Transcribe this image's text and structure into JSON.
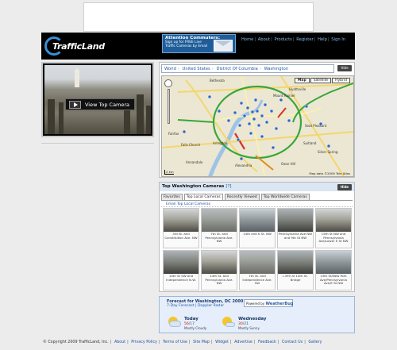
{
  "header": {
    "logo": "TrafficLand",
    "promo": {
      "title": "Attention Commuters:",
      "text": "Sign up for FREE Live Traffic Cameras by Email"
    },
    "nav": [
      "Home",
      "About",
      "Products",
      "Register",
      "Help",
      "Sign In"
    ]
  },
  "video": {
    "play_label": "View Top Camera"
  },
  "map": {
    "breadcrumbs": [
      "World",
      "United States",
      "District Of Columbia",
      "Washington"
    ],
    "hide_label": "Hide",
    "types": [
      "Map",
      "Satellite",
      "Hybrid"
    ],
    "copyright": "Map data ©2009 Tele Atlas",
    "scale": "2 km",
    "places": [
      "Bethesda",
      "Silver Spring",
      "Hyattsville",
      "Arlington",
      "Falls Church",
      "Annandale",
      "Alexandria",
      "Oxon Hill",
      "Seat Pleasant",
      "Suitland",
      "Fairfax",
      "Mount Rainier"
    ]
  },
  "cameras": {
    "title": "Top Washington Cameras",
    "help": "[?]",
    "hide_label": "Hide",
    "tabs": [
      "Favorites",
      "Top Local Cameras",
      "Recently Viewed",
      "Top Worldwide Cameras"
    ],
    "email_text": "Email Top Local Cameras",
    "items": [
      "3rd St. and Constitution Ave. NW",
      "7th St. and Pennsylvania Ave. NW",
      "14th and K St. NW",
      "Pennsylvania Ave NW and 9th St NW",
      "15th St NW and Pennsylvania Ave/Lower E St NW",
      "14th St SW and Independence N.W.",
      "14th St. and Pennsylvania Ave. NW",
      "7th St. and Independence Ave. SW",
      "I-395 at 14th St. Bridge",
      "15th St/New York Ave/Pennsylvania Ave/E St NW"
    ]
  },
  "weather": {
    "title": "Forecast for Washington, DC 20001",
    "links": "7-Day Forecast | Doppler Radar",
    "powered": "Powered by",
    "brand": "WeatherBug",
    "days": [
      {
        "name": "Today",
        "hi": "56",
        "lo": "17",
        "cond": "Mostly Cloudy"
      },
      {
        "name": "Wednesday",
        "hi": "30",
        "lo": "21",
        "cond": "Mostly Sunny"
      }
    ]
  },
  "footer": {
    "copyright": "© Copyright 2009 TrafficLand, Inc.",
    "links": [
      "About",
      "Privacy Policy",
      "Terms of Use",
      "Site Map",
      "Widget",
      "Advertise",
      "Feedback",
      "Contact Us",
      "Gallery"
    ]
  }
}
